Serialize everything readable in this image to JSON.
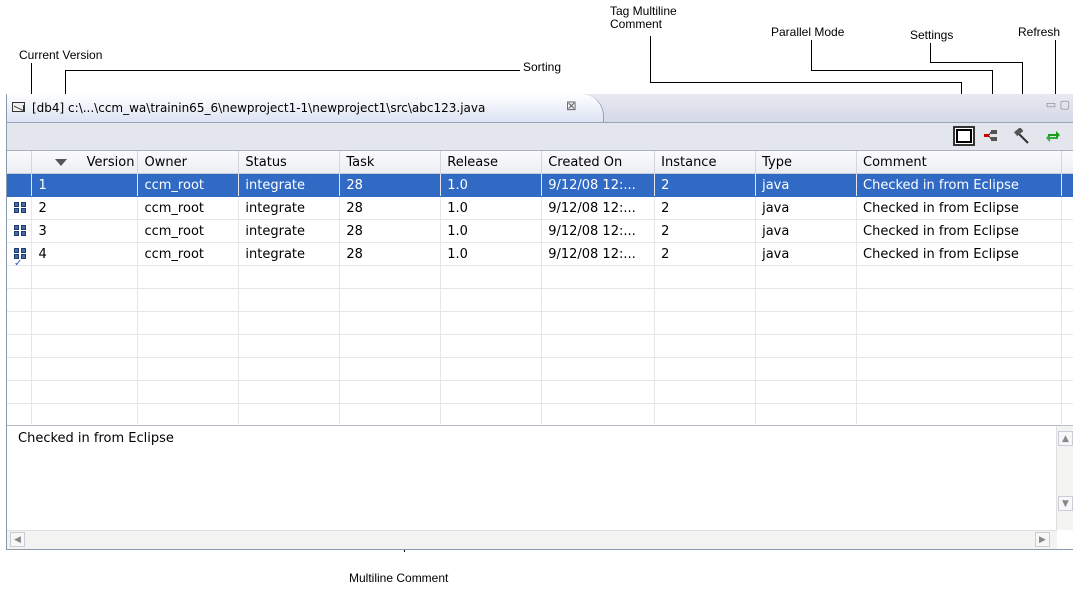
{
  "callouts": {
    "tag_multiline_comment": [
      "Tag Multiline",
      "Comment"
    ],
    "parallel_mode": "Parallel Mode",
    "settings": "Settings",
    "refresh": "Refresh",
    "current_version": "Current Version",
    "sorting": "Sorting",
    "multiline_comment": "Multiline Comment"
  },
  "editor_tab": {
    "label": "[db4] c:\\...\\ccm_wa\\trainin65_6\\newproject1-1\\newproject1\\src\\abc123.java",
    "close_glyph": "⊠"
  },
  "window_buttons": "▭ ▢",
  "toolbar": {
    "icons": [
      "tag-multiline-comment-icon",
      "parallel-mode-icon",
      "settings-icon",
      "refresh-icon"
    ],
    "refresh_color": "#1a9e1a",
    "parallel_color": "#cc0000"
  },
  "table": {
    "columns": [
      "Version",
      "Owner",
      "Status",
      "Task",
      "Release",
      "Created On",
      "Instance",
      "Type",
      "Comment"
    ],
    "rows": [
      {
        "version": "1",
        "owner": "ccm_root",
        "status": "integrate",
        "task": "28",
        "release": "1.0",
        "created_on": "9/12/08 12:...",
        "instance": "2",
        "type": "java",
        "comment": "Checked in from Eclipse",
        "selected": true,
        "icon": "none"
      },
      {
        "version": "2",
        "owner": "ccm_root",
        "status": "integrate",
        "task": "28",
        "release": "1.0",
        "created_on": "9/12/08 12:...",
        "instance": "2",
        "type": "java",
        "comment": "Checked in from Eclipse",
        "selected": false,
        "icon": "version-object-icon"
      },
      {
        "version": "3",
        "owner": "ccm_root",
        "status": "integrate",
        "task": "28",
        "release": "1.0",
        "created_on": "9/12/08 12:...",
        "instance": "2",
        "type": "java",
        "comment": "Checked in from Eclipse",
        "selected": false,
        "icon": "version-object-icon"
      },
      {
        "version": "4",
        "owner": "ccm_root",
        "status": "integrate",
        "task": "28",
        "release": "1.0",
        "created_on": "9/12/08 12:...",
        "instance": "2",
        "type": "java",
        "comment": "Checked in from Eclipse",
        "selected": false,
        "icon": "current-version-icon"
      }
    ],
    "selection_color": "#316ac5"
  },
  "comment_pane": {
    "text": "Checked in from Eclipse"
  }
}
